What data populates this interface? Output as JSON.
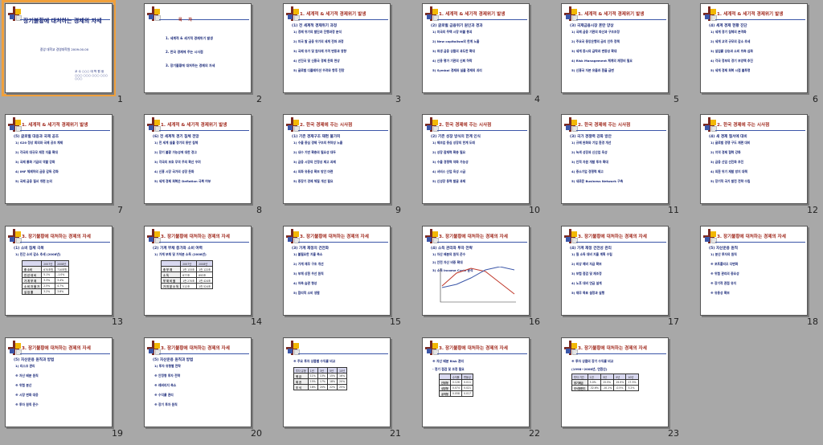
{
  "slides": [
    {
      "num": "1",
      "type": "title",
      "title": "장기불황에 대처하는 경제의 자세",
      "subtitle": "중앙 대학교 경영대학원 2009.00.00",
      "author": "교 수 ○○○ 대 학 원 생 ○○○ ○○○ ○○○ ○○○ ○○○"
    },
    {
      "num": "2",
      "type": "toc",
      "title": "목 차",
      "items": [
        "1. 세계적 & 세기적 경제위기 발생",
        "2. 한국 경제에 주는 시사점",
        "3. 장기불황에 대처하는 경제의 자세"
      ]
    },
    {
      "num": "3",
      "title": "1. 세계적 & 세기적 경제위기 발생",
      "sub": "(1) 전 세계적 경제위기 과정",
      "items": [
        "1) 경제 위기의 발단과 진행과정 분석",
        "2) 미국 발 금융 위기의 세계 전파 과정",
        "3) 국제 유가 및 원자재 가격 변동과 영향",
        "4) 선진국 및 신흥국 경제 둔화 현상",
        "5) 글로벌 디플레이션 우려와 향후 전망"
      ]
    },
    {
      "num": "4",
      "title": "1. 세계적 & 세기적 경제위기 발생",
      "sub": "(2) 글로벌 금융위기 원인과 경과",
      "items": [
        "1) 미국의 주택 시장 버블 붕괴",
        "2) New capitalism의 한계 노출",
        "3) 파생 금융 상품의 과도한 확대",
        "4) 신용 평가 기관의 신뢰 하락",
        "5) Symbol 경제와 실물 경제의 괴리"
      ]
    },
    {
      "num": "5",
      "title": "1. 세계적 & 세기적 경제위기 발생",
      "sub": "(3) 국제금융시장 혼란 양상",
      "items": [
        "1) 국제 금융 기관의 파산과 구조조정",
        "2) 주요국 중앙은행의 금리 인하 정책",
        "3) 세계 증시의 급락과 변동성 확대",
        "4) Risk Management 체계의 재정비 필요",
        "5) 신흥국 자본 유출과 환율 급변"
      ]
    },
    {
      "num": "6",
      "title": "1. 세계적 & 세기적 경제위기 발생",
      "sub": "(4) 세계 경제 현황 진단",
      "items": [
        "1) 세계 경기 침체의 본격화",
        "2) 세계 교역 규모의 감소 추세",
        "3) 실업률 상승과 소비 위축 심화",
        "4) 각국 정부의 경기 부양책 추진",
        "5) 세계 경제 회복 시점 불투명"
      ]
    },
    {
      "num": "7",
      "title": "1. 세계적 & 세기적 경제위기 발생",
      "sub": "(5) 글로벌 대응과 국제 공조",
      "items": [
        "1) G20 정상 회의와 국제 공조 체제",
        "2) 각국의 대규모 재정 지출 확대",
        "3) 국제 통화 기금의 역할 강화",
        "4) IMF 체제하의 금융 감독 강화",
        "5) 국제 금융 질서 개편 논의"
      ]
    },
    {
      "num": "8",
      "title": "1. 세계적 & 세기적 경제위기 발생",
      "sub": "(6) 전 세계적 경기 침체 전망",
      "items": [
        "1) 전 세계 실물 경기의 동반 침체",
        "2) 장기 불황 가능성에 대한 경고",
        "3) 각국의 보호 무역 주의 확산 우려",
        "4) 신흥 시장 국가의 성장 둔화",
        "5) 세계 경제 회복은 Deflation 극복 여부"
      ]
    },
    {
      "num": "9",
      "title": "2. 한국 경제에 주는 시사점",
      "sub": "(1) 기존 경제구조 재편 불가피",
      "items": [
        "1) 수출 중심 경제 구조의 취약성 노출",
        "2) 내수 기반 확충의 필요성 대두",
        "3) 금융 시장의 안정성 제고 과제",
        "4) 외화 유동성 확보 방안 마련",
        "5) 중장기 경제 체질 개선 필요"
      ]
    },
    {
      "num": "10",
      "title": "2. 한국 경제에 주는 시사점",
      "sub": "(2) 기존 성장 방식의 한계 인식",
      "items": [
        "1) 제조업 중심 성장의 한계 도래",
        "2) 성장 잠재력 확충 필요",
        "3) 수출 경쟁력 약화 가능성",
        "4) 서비스 산업 육성 시급",
        "5) 신성장 동력 발굴 과제"
      ]
    },
    {
      "num": "11",
      "title": "2. 한국 경제에 주는 시사점",
      "sub": "(3) 국가 경쟁력 강화 방안",
      "items": [
        "1) 규제 완화와 기업 환경 개선",
        "2) 녹색 성장과 신산업 육성",
        "3) 인적 자원 개발 투자 확대",
        "4) 중소기업 경쟁력 제고",
        "5) 새로운 Business Network 구축"
      ]
    },
    {
      "num": "12",
      "title": "2. 한국 경제에 주는 시사점",
      "sub": "(4) 새 경제 질서에 대비",
      "items": [
        "1) 글로벌 경쟁 구도 재편 대비",
        "2) 지역 경제 협력 강화",
        "3) 금융 산업 선진화 추진",
        "4) 외환 위기 재발 방지 대책",
        "5) 장기적 국가 발전 전략 수립"
      ]
    },
    {
      "num": "13",
      "title": "3. 장기불황에 대처하는 경제의 자세",
      "sub": "(1) 소비 침체 극복",
      "items": [
        "1) 민간 소비 감소 추세 (2008년)"
      ],
      "table": {
        "header": [
          "",
          "2007년",
          "2008년"
        ],
        "rows": [
          [
            "총 소비",
            "670조원",
            "710조원"
          ],
          [
            "전 년 대 비",
            "5.1%",
            "-1.0%"
          ],
          [
            "가 계 부 채",
            "3.3%",
            "3.4%"
          ],
          [
            "소 비 자 물 가",
            "2.5%",
            "4.7%"
          ],
          [
            "실 업 률",
            "3.2%",
            "3.6%"
          ]
        ]
      }
    },
    {
      "num": "14",
      "title": "3. 장기불황에 대처하는 경제의 자세",
      "sub": "(2) 가계 부채 증가와 소비 여력",
      "items": [
        "1) 가계 부채 및 가처분 소득 (2008년)"
      ],
      "table": {
        "header": [
          "",
          "2007년",
          "2008년"
        ],
        "rows": [
          [
            "총 부 채",
            "1천 133조",
            "1천 122조"
          ],
          [
            "소 득",
            "677조",
            "693조"
          ],
          [
            "부 채 비 율",
            "1천 270조",
            "1천 424조"
          ],
          [
            "가 처 분 소 득",
            "512조",
            "1천 524조"
          ]
        ]
      }
    },
    {
      "num": "15",
      "title": "3. 장기불황에 대처하는 경제의 자세",
      "sub": "(3) 가계 재정의 건전화",
      "items": [
        "1) 불필요한 지출 축소",
        "2) 가계 재무 구조 개선",
        "3) 부채 상환 우선 원칙",
        "4) 저축 습관 형성",
        "5) 합리적 소비 생활"
      ]
    },
    {
      "num": "16",
      "title": "3. 장기불황에 대처하는 경제의 자세",
      "sub": "(4) 소득 관리와 투자 전략",
      "items": [
        "1) 자산 배분의 원칙 준수",
        "2) 안전 자산 비중 확대",
        "3) 소득 Income Cycle 분석"
      ],
      "chart": {
        "type": "line",
        "series": [
          {
            "values": [
              20,
              36,
              42,
              38,
              24,
              10
            ]
          },
          {
            "values": [
              18,
              22,
              30,
              40,
              44,
              40
            ]
          }
        ]
      }
    },
    {
      "num": "17",
      "title": "3. 장기불황에 대처하는 경제의 자세",
      "sub": "(4) 가계 재정 건전성 관리",
      "items": [
        "1) 월 소득 대비 지출 계획 수립",
        "2) 비상 예비 자금 확보",
        "3) 보험 점검 및 재조정",
        "4) 노후 대비 연금 설계",
        "5) 재무 목표 설정과 실행"
      ]
    },
    {
      "num": "18",
      "title": "3. 장기불황에 대처하는 경제의 자세",
      "sub": "(5) 자산운용 원칙",
      "items": [
        "1) 분산 투자의 원칙",
        "※ 포트폴리오 다변화",
        "※ 위험 관리의 중요성",
        "※ 장기적 관점 유지",
        "※ 유동성 확보"
      ]
    },
    {
      "num": "19",
      "title": "3. 장기불황에 대처하는 경제의 자세",
      "sub": "(5) 자산운용 원칙과 방법",
      "items": [
        "1) 리스크 관리",
        "※ 자산 배분 원칙",
        "※ 위험 분산",
        "※ 시장 변화 대응",
        "※ 투자 원칙 준수"
      ]
    },
    {
      "num": "20",
      "title": "3. 장기불황에 대처하는 경제의 자세",
      "sub": "(5) 자산운용 원칙과 방법",
      "items": [
        "1) 투자 유형별 전략",
        "※ 안정형 투자 전략",
        "※ 레버리지 축소",
        "※ 수익률 관리",
        "※ 장기 투자 원칙"
      ]
    },
    {
      "num": "21",
      "title": "",
      "sub": "",
      "items": [
        "※ 주요 투자 상품별 수익률 비교"
      ],
      "table": {
        "header": [
          "투자 유형",
          "1년",
          "3년",
          "5년",
          "10년"
        ],
        "rows": [
          [
            "예 금",
            "11%",
            "13%",
            "15%",
            "16%"
          ],
          [
            "채 권",
            "15%",
            "17%",
            "18%",
            "20%"
          ],
          [
            "주 식",
            "18%",
            "20%",
            "22%",
            "25%"
          ]
        ]
      }
    },
    {
      "num": "22",
      "title": "3. 장기불황에 대처하는 경제의 자세",
      "sub": "",
      "items": [
        "※ 자산 배분 Risk 관리",
        "- 정기 점검 및 조정 필요"
      ],
      "table": {
        "header": [
          "",
          "수익률",
          "변동성"
        ],
        "rows": [
          [
            "안정형",
            "0.126",
            "0.011"
          ],
          [
            "성장형",
            "0.074",
            "0.021"
          ],
          [
            "공격형",
            "0.058",
            "0.017"
          ]
        ]
      }
    },
    {
      "num": "23",
      "title": "3. 장기불황에 대처하는 경제의 자세",
      "sub": "",
      "items": [
        "※ 투자 상품의 장기 수익률 비교",
        "(1998~2008년, 연환산)"
      ],
      "table": {
        "header": [
          "투자 기간",
          "1년",
          "3년",
          "5년",
          "10년"
        ],
        "rows": [
          [
            "정기예금",
            "5.0%",
            "15.5%",
            "19.9%",
            "17.5%"
          ],
          [
            "주식형펀드",
            "-32.6%",
            "-10.1%",
            "-0.5%",
            "3.2%"
          ]
        ]
      }
    }
  ]
}
